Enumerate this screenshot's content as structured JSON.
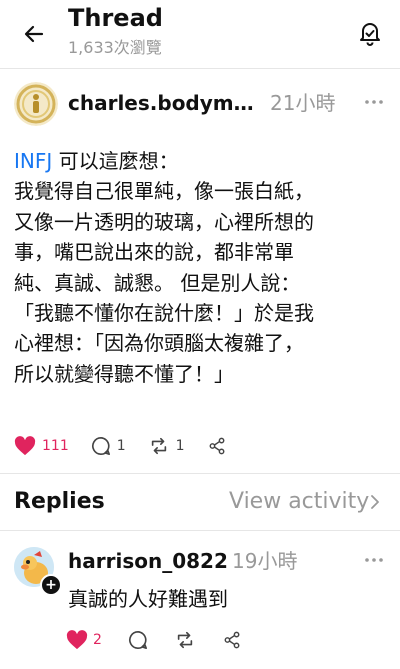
{
  "header": {
    "title": "Thread",
    "views": "1,633次瀏覽"
  },
  "post": {
    "username": "charles.bodymi...",
    "time": "21小時",
    "tag": "INFJ",
    "lines": [
      " 可以這麼想：",
      "我覺得自己很單純，像一張白紙，",
      "又像一片透明的玻璃，心裡所想的",
      "事，嘴巴說出來的說，都非常單",
      "純、真誠、誠懇。 但是別人說：",
      "「我聽不懂你在說什麼！」於是我",
      "心裡想：「因為你頭腦太複雜了，",
      "所以就變得聽不懂了！」"
    ],
    "likes": "111",
    "comments": "1",
    "reposts": "1"
  },
  "replies_section": {
    "title": "Replies",
    "view_activity": "View activity"
  },
  "reply": {
    "username": "harrison_0822",
    "time": "19小時",
    "text": "真誠的人好難遇到",
    "likes": "2"
  },
  "colors": {
    "like": "#e0245e",
    "tag": "#1877f2",
    "muted": "#999999"
  }
}
